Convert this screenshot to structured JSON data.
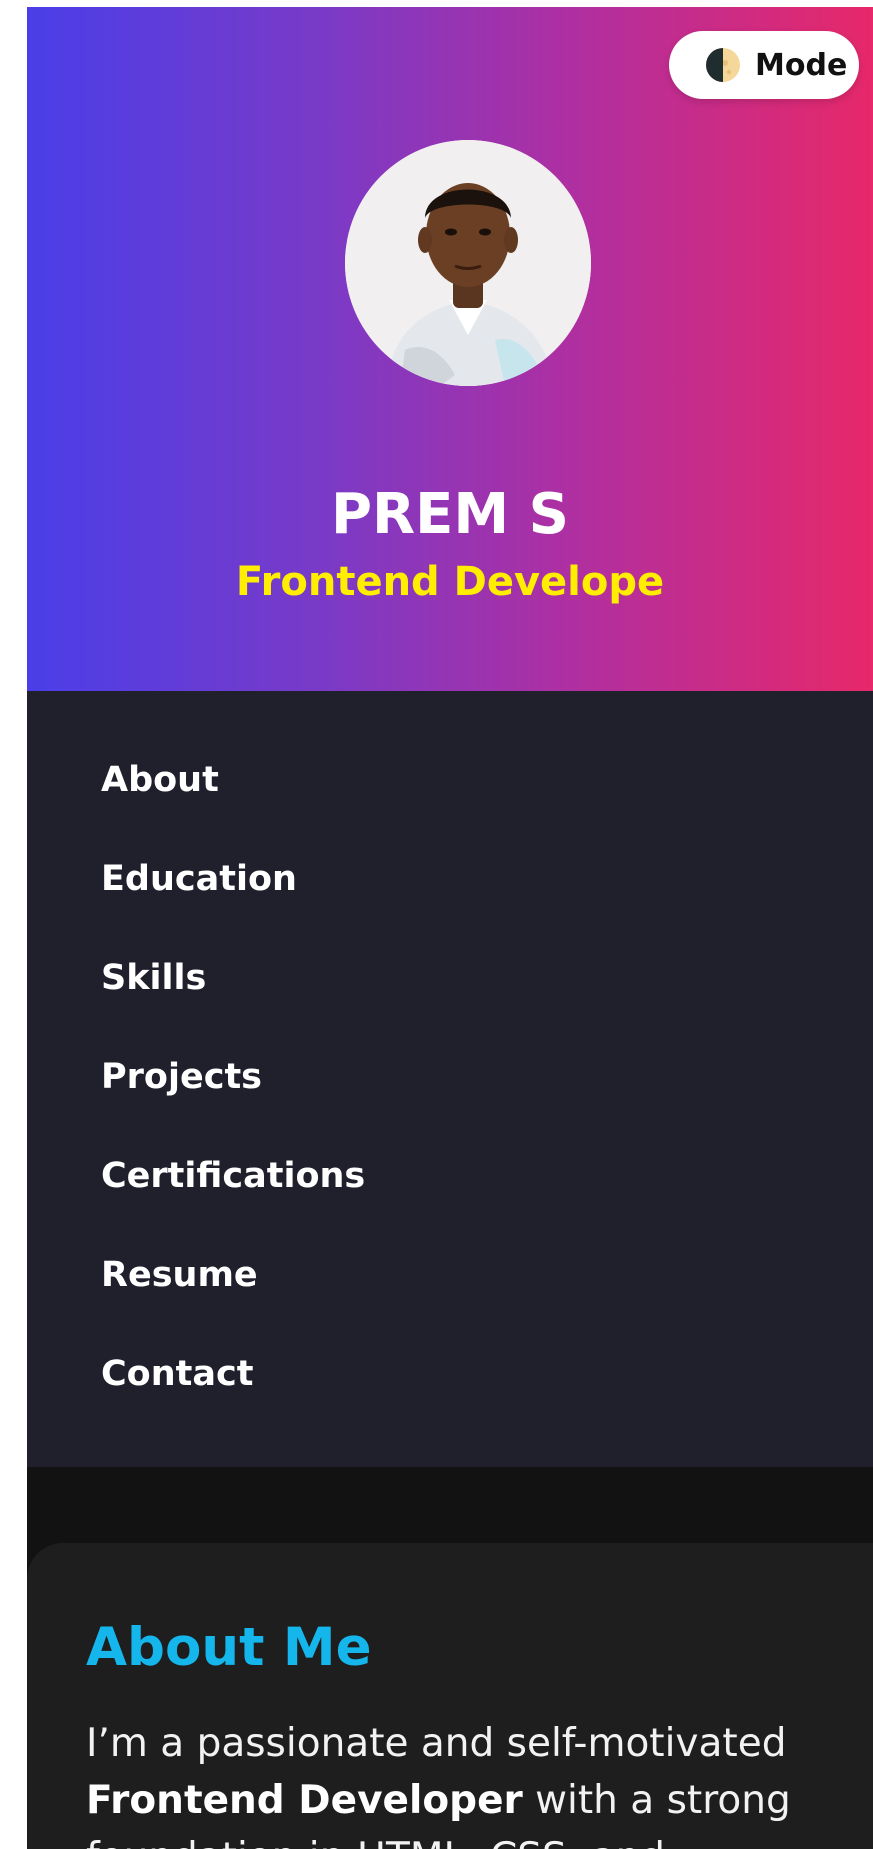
{
  "header": {
    "mode_label": "Mode",
    "mode_icon": "half-moon-icon",
    "name": "PREM S",
    "role": "Frontend Develope",
    "gradient_colors": [
      "#4a3ee8",
      "#b02fa0",
      "#e7286a"
    ],
    "role_color": "#ffee00"
  },
  "nav": {
    "items": [
      {
        "label": "About"
      },
      {
        "label": "Education"
      },
      {
        "label": "Skills"
      },
      {
        "label": "Projects"
      },
      {
        "label": "Certifications"
      },
      {
        "label": "Resume"
      },
      {
        "label": "Contact"
      }
    ]
  },
  "about": {
    "title": "About Me",
    "title_color": "#15b6ec",
    "text_part1": "I’m a passionate and self-motivated ",
    "text_bold": "Frontend Developer",
    "text_part2": " with a strong foundation in HTML, CSS, and"
  }
}
